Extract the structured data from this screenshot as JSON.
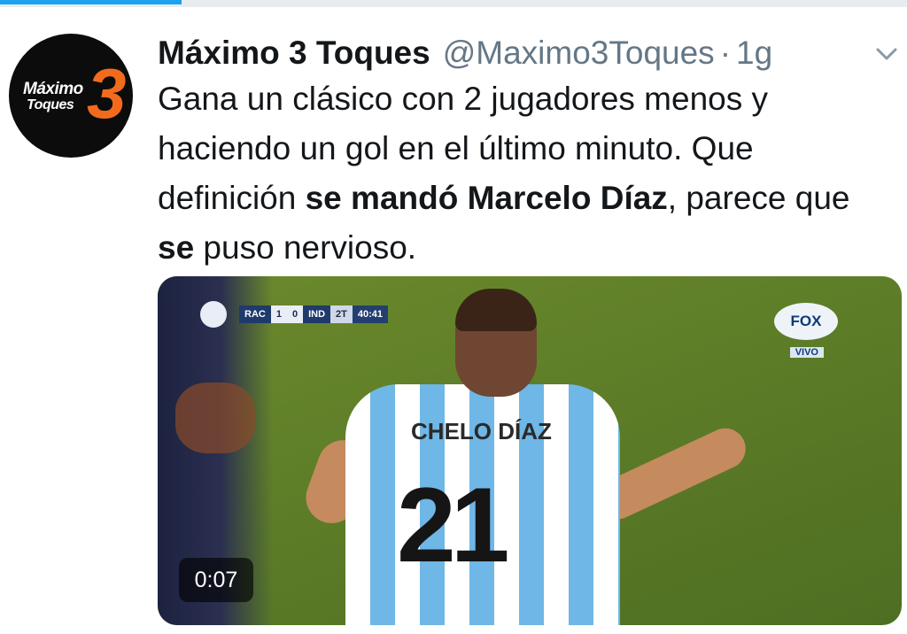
{
  "progress": {
    "value": 0.2
  },
  "avatar": {
    "line1": "Máximo",
    "line2": "Toques",
    "numeral": "3",
    "accent_color": "#f26b1d"
  },
  "tweet": {
    "display_name": "Máximo 3 Toques",
    "handle": "@Maximo3Toques",
    "separator": "·",
    "time": "1g",
    "text_parts": {
      "p1": "Gana un clásico con 2 jugadores menos y haciendo un gol en el último minuto. Que definición ",
      "b1": "se mandó Marcelo Díaz",
      "p2": ", parece que ",
      "b2": "se",
      "p3": " puso nervioso."
    }
  },
  "video": {
    "duration": "0:07",
    "scorebug": {
      "home": "RAC",
      "home_score": "1",
      "away_score": "0",
      "away": "IND",
      "half": "2T",
      "clock": "40:41"
    },
    "broadcaster": "FOX",
    "live_label": "VIVO",
    "jersey_name": "CHELO DÍAZ",
    "jersey_number": "21"
  },
  "icons": {
    "menu": "chevron-down-icon"
  },
  "colors": {
    "accent": "#1da1f2",
    "secondary_text": "#657786"
  }
}
